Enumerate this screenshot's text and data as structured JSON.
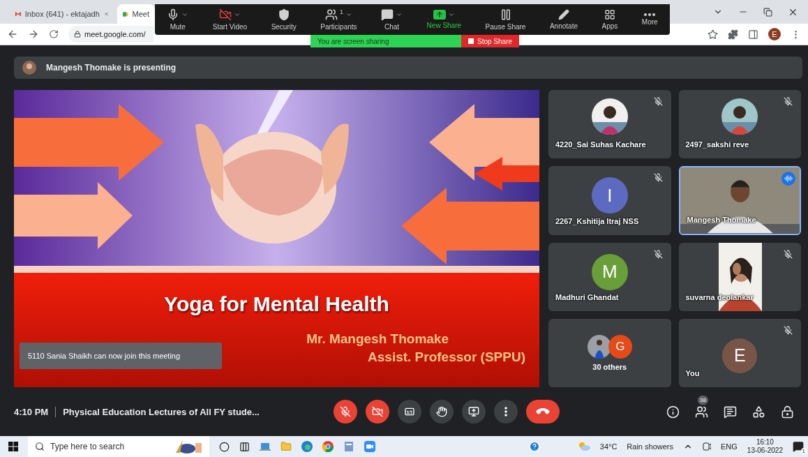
{
  "browser": {
    "tabs": [
      {
        "title": "Inbox (641) - ektajadh",
        "kind": "mail",
        "selected": false
      },
      {
        "title": "Meet",
        "kind": "meet",
        "selected": true
      }
    ],
    "url": "meet.google.com/",
    "profile_initial": "E"
  },
  "zoom_toolbar": {
    "items": [
      {
        "label": "Mute",
        "kind": "mic",
        "dropdown": true
      },
      {
        "label": "Start Video",
        "kind": "video_off",
        "dropdown": true
      },
      {
        "label": "Security",
        "kind": "security",
        "dropdown": false
      },
      {
        "label": "Participants",
        "kind": "participants",
        "dropdown": true,
        "count": "1"
      },
      {
        "label": "Chat",
        "kind": "chat",
        "dropdown": true
      },
      {
        "label": "New Share",
        "kind": "new_share",
        "dropdown": true
      },
      {
        "label": "Pause Share",
        "kind": "pause",
        "dropdown": false
      },
      {
        "label": "Annotate",
        "kind": "annotate",
        "dropdown": false
      },
      {
        "label": "Apps",
        "kind": "apps",
        "dropdown": false
      },
      {
        "label": "More",
        "kind": "more",
        "dropdown": false
      }
    ]
  },
  "share_banner": {
    "text": "You are screen sharing",
    "stop_label": "Stop Share"
  },
  "presenting": {
    "text": "Mangesh Thomake is presenting"
  },
  "slide": {
    "title": "Yoga for Mental Health",
    "presenter": "Mr. Mangesh Thomake",
    "role": "Assist. Professor (SPPU)"
  },
  "toast": {
    "text": "5110 Sania Shaikh can now join this meeting"
  },
  "tiles": [
    {
      "name": "4220_Sai Suhas Kachare",
      "muted": true,
      "speaking": false
    },
    {
      "name": "2497_sakshi reve",
      "muted": true,
      "speaking": false
    },
    {
      "name": "2267_Kshitija Itraj NSS",
      "kind": "letter",
      "initial": "I",
      "color": "#5c6bc0",
      "muted": true,
      "speaking": false
    },
    {
      "name": "Mangesh Thomake",
      "kind": "video",
      "muted": false,
      "speaking": true
    },
    {
      "name": "Madhuri Ghandat",
      "kind": "letter",
      "initial": "M",
      "color": "#689f38",
      "muted": true,
      "speaking": false
    },
    {
      "name": "suvarna deolankar",
      "kind": "portrait_video",
      "muted": true,
      "speaking": false
    },
    {
      "name": "30 others",
      "kind": "group",
      "initial": "G",
      "color": "#e64a19",
      "muted": false,
      "speaking": false
    },
    {
      "name": "You",
      "kind": "letter",
      "initial": "E",
      "color": "#795548",
      "muted": true,
      "speaking": false
    }
  ],
  "meeting_bar": {
    "time": "4:10 PM",
    "title": "Physical Education Lectures of All FY stude...",
    "mic_on": false,
    "camera_on": false,
    "people_count": "38"
  },
  "taskbar": {
    "search_placeholder": "Type here to search",
    "temperature": "34°C",
    "weather": "Rain showers",
    "language": "ENG",
    "time": "16:10",
    "date": "13-06-2022",
    "notification_count": "1"
  }
}
